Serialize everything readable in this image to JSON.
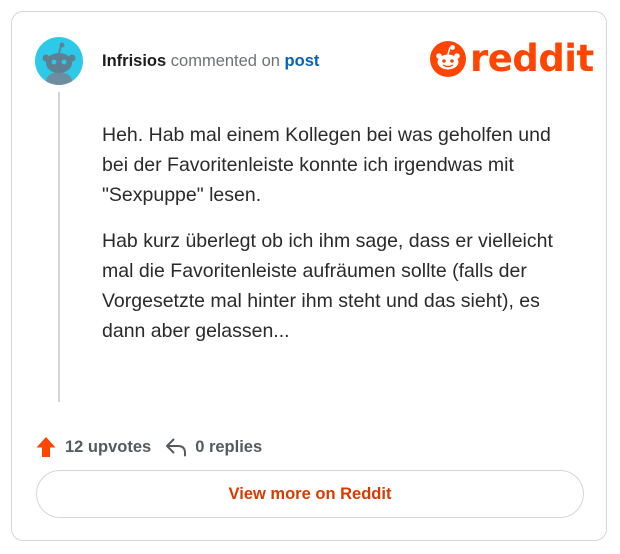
{
  "comment": {
    "username": "Infrisios",
    "action_text": "commented on",
    "post_link": "post",
    "paragraphs": [
      "Heh. Hab mal einem Kollegen bei was geholfen und bei der Favoritenleiste konnte ich irgendwas mit \"Sexpuppe\" lesen.",
      "Hab kurz überlegt ob ich ihm sage, dass er vielleicht mal die Favoritenleiste aufräumen sollte (falls der Vorgesetzte mal hinter ihm steht und das sieht), es dann aber gelassen..."
    ],
    "upvotes": "12 upvotes",
    "replies": "0 replies"
  },
  "brand": {
    "logo_text": "reddit",
    "accent_color": "#ff4500",
    "avatar_color": "#2dc9e8"
  },
  "cta": {
    "label": "View more on Reddit"
  },
  "icons": {
    "avatar": "snoo-avatar-icon",
    "logo": "reddit-snoo-icon",
    "upvote": "upvote-arrow-icon",
    "reply": "reply-arrow-icon"
  }
}
